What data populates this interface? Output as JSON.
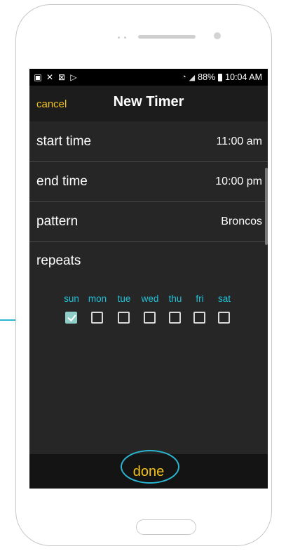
{
  "status_bar": {
    "left_icons": [
      "image-icon",
      "shuffle-icon",
      "close-box-icon",
      "play-icon"
    ],
    "battery": "88%",
    "time": "10:04 AM"
  },
  "header": {
    "cancel_label": "cancel",
    "title": "New Timer"
  },
  "rows": {
    "start_time": {
      "label": "start time",
      "value": "11:00 am"
    },
    "end_time": {
      "label": "end time",
      "value": "10:00 pm"
    },
    "pattern": {
      "label": "pattern",
      "value": "Broncos"
    }
  },
  "repeats": {
    "label": "repeats",
    "days": [
      {
        "name": "sun",
        "checked": true
      },
      {
        "name": "mon",
        "checked": false
      },
      {
        "name": "tue",
        "checked": false
      },
      {
        "name": "wed",
        "checked": false
      },
      {
        "name": "thu",
        "checked": false
      },
      {
        "name": "fri",
        "checked": false
      },
      {
        "name": "sat",
        "checked": false
      }
    ]
  },
  "footer": {
    "done_label": "done"
  },
  "colors": {
    "accent_yellow": "#f2c21b",
    "accent_cyan": "#22c1d9",
    "checked_fill": "#8fcdc9",
    "highlight_ring": "#2ab6d0"
  }
}
